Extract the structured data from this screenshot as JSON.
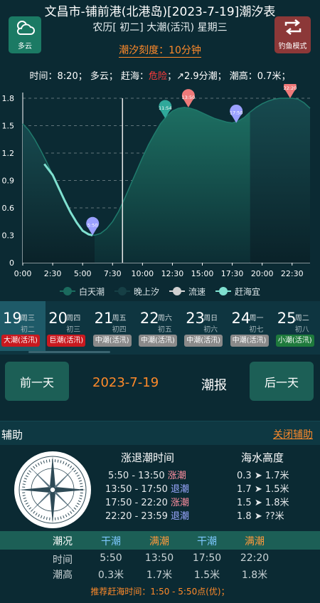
{
  "header": {
    "title": "文昌市-铺前港(北港岛)[2023-7-19]潮汐表",
    "subtitle": "农历[ 初二] 大潮(活汛) 星期三",
    "weather_label": "多云",
    "fishing_mode_label": "钓鱼模式",
    "scale_text": "潮汐刻度：10分钟",
    "info_time": "时间：8:20；",
    "info_weather": "多云；",
    "info_sea_label": "赶海：",
    "info_sea_value": "危险",
    "info_wind": "；↗2.9分潮；",
    "info_height": "潮高：0.7米；"
  },
  "colors": {
    "accent_orange": "#ff8a2a",
    "danger": "#ff3b3b",
    "rise": "#ff8fa0",
    "fall": "#9aa8ff",
    "button_green": "#1c5f56",
    "day_curve": "#1b6b5e",
    "night_curve": "#163f45",
    "sea_curve": "#7fe0d0",
    "marker_low": "#9aa0ff",
    "marker_high": "#f07a7a",
    "marker_mid": "#2fa89a"
  },
  "chart_data": {
    "type": "area",
    "x_ticks": [
      "0:00",
      "2:30",
      "5:00",
      "7:30",
      "10:00",
      "12:30",
      "15:00",
      "17:30",
      "20:00",
      "22:30"
    ],
    "y_ticks": [
      "0",
      "0.3",
      "0.6",
      "0.9",
      "1.2",
      "1.5",
      "1.8"
    ],
    "ylim": [
      0,
      1.8
    ],
    "xlim_hours": [
      0,
      24
    ],
    "series": [
      {
        "name": "白天潮",
        "x": [
          6.0,
          6.5,
          7,
          7.5,
          8,
          8.5,
          9,
          9.5,
          10,
          10.5,
          11,
          11.5,
          12,
          12.5,
          13,
          13.5,
          14,
          14.5,
          15,
          15.5,
          16,
          16.5,
          17,
          17.5,
          18,
          18.5,
          19
        ],
        "values": [
          0.3,
          0.32,
          0.37,
          0.45,
          0.56,
          0.7,
          0.85,
          1.0,
          1.15,
          1.29,
          1.41,
          1.52,
          1.6,
          1.66,
          1.69,
          1.7,
          1.69,
          1.67,
          1.64,
          1.61,
          1.58,
          1.56,
          1.54,
          1.53,
          1.55,
          1.59,
          1.65
        ]
      },
      {
        "name": "晚上汐",
        "x": [
          0,
          0.5,
          1,
          1.5,
          2,
          2.5,
          3,
          3.5,
          4,
          4.5,
          5,
          5.5,
          6
        ],
        "values": [
          1.52,
          1.45,
          1.35,
          1.23,
          1.1,
          0.96,
          0.82,
          0.68,
          0.55,
          0.44,
          0.35,
          0.31,
          0.3
        ]
      },
      {
        "name": "晚上汐",
        "x": [
          19,
          19.5,
          20,
          20.5,
          21,
          21.5,
          22,
          22.5,
          23,
          23.5,
          24
        ],
        "values": [
          1.65,
          1.7,
          1.74,
          1.77,
          1.79,
          1.8,
          1.8,
          1.8,
          1.79,
          1.75,
          1.69
        ]
      },
      {
        "name": "赶海宜",
        "x": [
          1.8,
          2.5,
          3,
          3.5,
          4,
          4.5,
          5,
          5.5,
          5.83
        ],
        "values": [
          1.08,
          0.96,
          0.82,
          0.68,
          0.55,
          0.44,
          0.35,
          0.31,
          0.3
        ]
      }
    ],
    "markers": [
      {
        "time": "5:50",
        "hour": 5.833,
        "value": 0.3,
        "kind": "low"
      },
      {
        "time": "11:54",
        "hour": 11.9,
        "value": 1.58,
        "kind": "mid"
      },
      {
        "time": "13:50",
        "hour": 13.833,
        "value": 1.7,
        "kind": "high"
      },
      {
        "time": "17:50",
        "hour": 17.833,
        "value": 1.53,
        "kind": "low"
      },
      {
        "time": "22:20",
        "hour": 22.333,
        "value": 1.8,
        "kind": "high"
      }
    ],
    "current_time_hour": 8.333,
    "legend": [
      "白天潮",
      "晚上汐",
      "流速",
      "赶海宜"
    ]
  },
  "dates": [
    {
      "day": "19",
      "weekday": "周三",
      "lunar": "初二",
      "tag": "大潮(活汛)",
      "tag_color": "#c8191f",
      "active": true
    },
    {
      "day": "20",
      "weekday": "周四",
      "lunar": "初三",
      "tag": "巨潮(活汛)",
      "tag_color": "#c8191f",
      "active": false
    },
    {
      "day": "21",
      "weekday": "周五",
      "lunar": "初四",
      "tag": "中潮(活汛)",
      "tag_color": "#8a8a8a",
      "active": false
    },
    {
      "day": "22",
      "weekday": "周六",
      "lunar": "初五",
      "tag": "中潮(活汛)",
      "tag_color": "#8a8a8a",
      "active": false
    },
    {
      "day": "23",
      "weekday": "周日",
      "lunar": "初六",
      "tag": "中潮(活汛)",
      "tag_color": "#8a8a8a",
      "active": false
    },
    {
      "day": "24",
      "weekday": "周一",
      "lunar": "初七",
      "tag": "中潮(活汛)",
      "tag_color": "#8a8a8a",
      "active": false
    },
    {
      "day": "25",
      "weekday": "周二",
      "lunar": "初八",
      "tag": "小潮(活汛)",
      "tag_color": "#1e7a3c",
      "active": false
    }
  ],
  "nav": {
    "prev_label": "前一天",
    "next_label": "后一天",
    "date": "2023-7-19",
    "report": "潮报"
  },
  "helper": {
    "title": "辅助",
    "close_label": "关闭辅助",
    "tide_time_header": "涨退潮时间",
    "height_header": "海水高度",
    "rows": [
      {
        "time": "5:50 - 13:50",
        "status": "涨潮",
        "kind": "rise",
        "from": "0.3",
        "to": "1.7米"
      },
      {
        "time": "13:50 - 17:50",
        "status": "退潮",
        "kind": "fall",
        "from": "1.7",
        "to": "1.5米"
      },
      {
        "time": "17:50 - 22:20",
        "status": "涨潮",
        "kind": "rise",
        "from": "1.5",
        "to": "1.8米"
      },
      {
        "time": "22:20 - 23:59",
        "status": "退潮",
        "kind": "fall",
        "from": "1.8",
        "to": "??米"
      }
    ],
    "arrow": "➤"
  },
  "table": {
    "head_label": "潮况",
    "row1_label": "时间",
    "row2_label": "潮高",
    "cols": [
      {
        "state": "干潮",
        "kind": "dry",
        "time": "5:50",
        "height": "0.3米"
      },
      {
        "state": "满潮",
        "kind": "full",
        "time": "13:50",
        "height": "1.7米"
      },
      {
        "state": "干潮",
        "kind": "dry",
        "time": "17:50",
        "height": "1.5米"
      },
      {
        "state": "满潮",
        "kind": "full",
        "time": "22:20",
        "height": "1.8米"
      }
    ]
  },
  "recommend": "推荐赶海时间：1:50 - 5:50点(优)；"
}
